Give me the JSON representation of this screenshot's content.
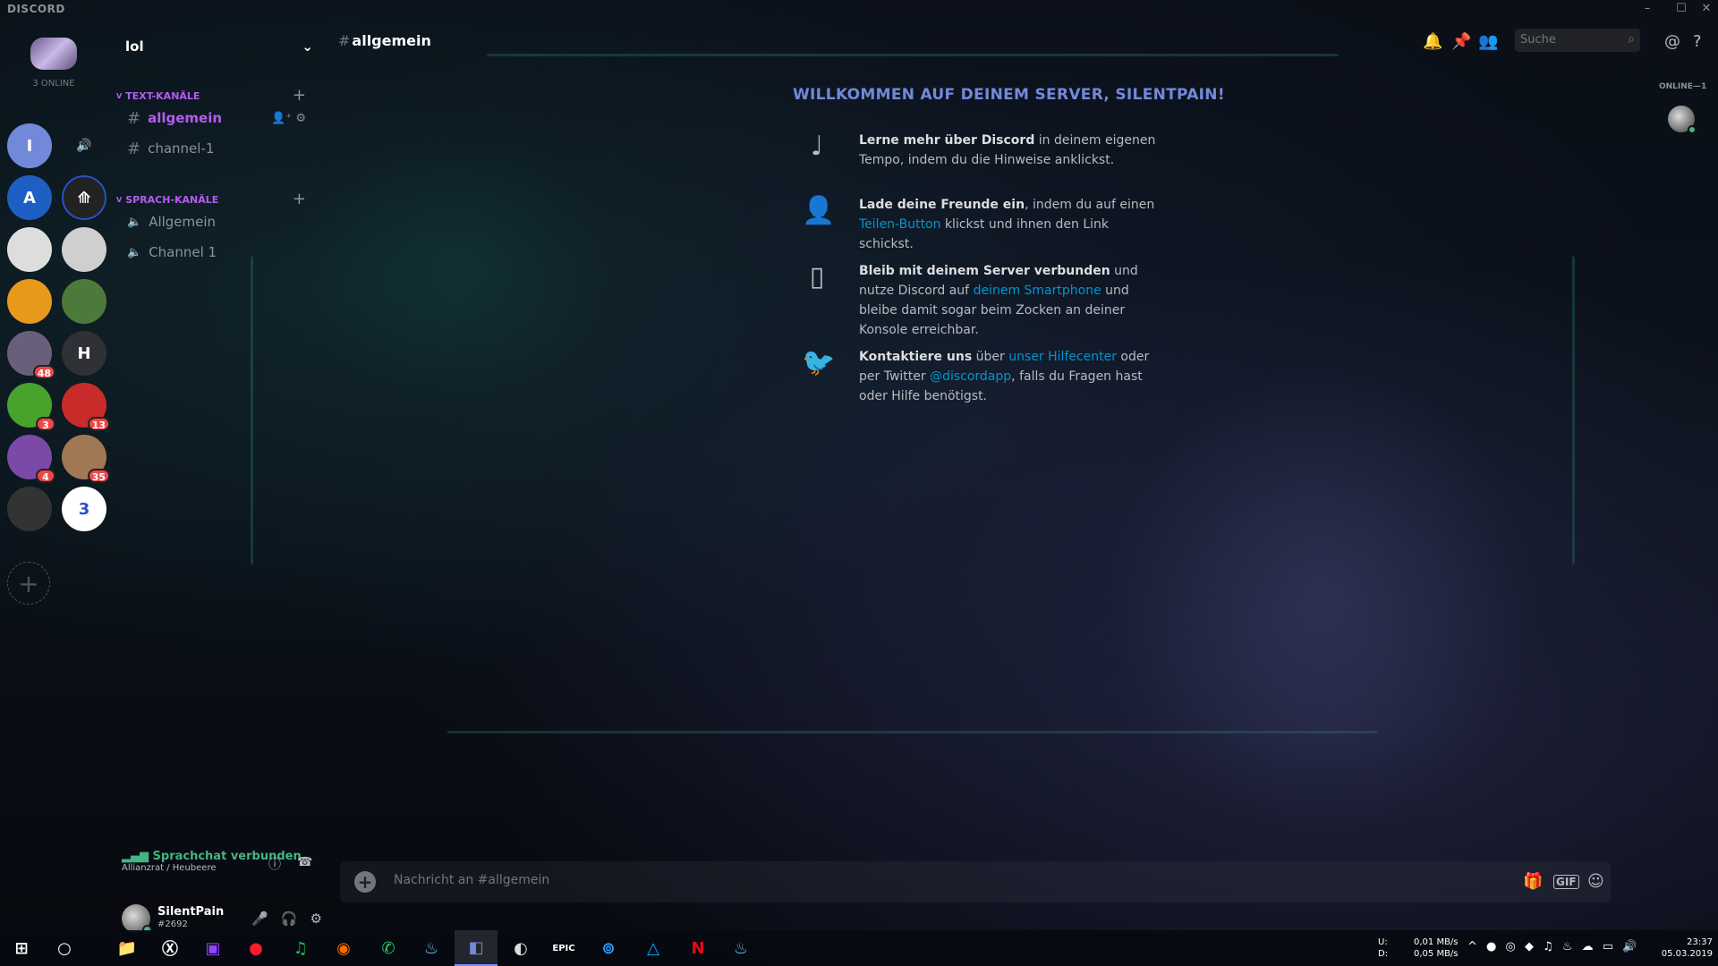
{
  "window": {
    "brand": "DISCORD",
    "minimize": "–",
    "maximize": "☐",
    "close": "✕"
  },
  "guilds": {
    "online_count": "3 ONLINE",
    "items": [
      {
        "label": "I",
        "color": "#7289da"
      },
      {
        "label": "A",
        "color": "#1d5fc4"
      },
      {
        "label": "",
        "color": "#222"
      },
      {
        "label": "",
        "color": "#ddd"
      },
      {
        "label": "",
        "color": "#cfcfcf"
      },
      {
        "label": "",
        "color": "#e69a1c"
      },
      {
        "label": "",
        "color": "#4d7a3a"
      },
      {
        "label": "",
        "color": "#6a5f7a"
      },
      {
        "label": "H",
        "color": "#2f3136"
      },
      {
        "label": "",
        "color": "#47a32c"
      },
      {
        "label": "",
        "color": "#c92a2a"
      },
      {
        "label": "",
        "color": "#7b4aa8"
      },
      {
        "label": "",
        "color": "#a07854"
      },
      {
        "label": "",
        "color": "#333"
      },
      {
        "label": "",
        "color": "#2a4fc9"
      }
    ],
    "badges": {
      "g8": "48",
      "g10": "3",
      "g11": "13",
      "g12": "4",
      "g13": "35"
    },
    "add_label": "+"
  },
  "server": {
    "name": "lol",
    "chevron": "⌄"
  },
  "categories": {
    "text": "TEXT-KANÄLE",
    "voice": "SPRACH-KANÄLE",
    "plus": "+",
    "caret": "v"
  },
  "text_channels": [
    {
      "hash": "#",
      "label": "allgemein"
    },
    {
      "hash": "#",
      "label": "channel-1"
    }
  ],
  "voice_channels": [
    {
      "icon": "🔈",
      "label": "Allgemein"
    },
    {
      "icon": "🔈",
      "label": "Channel 1"
    }
  ],
  "voice_status": {
    "title": "Sprachchat verbunden",
    "sub": "Allianzrat / Heubeere",
    "info": "ⓘ",
    "disconnect": "☎"
  },
  "user": {
    "name": "SilentPain",
    "disc": "#2692",
    "mic": "🎤",
    "headset": "🎧",
    "settings": "⚙"
  },
  "header": {
    "hash": "#",
    "channel": "allgemein",
    "bell": "🔔",
    "pin": "📌",
    "members": "👥",
    "search_placeholder": "Suche",
    "search_icon": "⌕",
    "at": "@",
    "help": "?"
  },
  "welcome": {
    "title": "WILLKOMMEN AUF DEINEM SERVER, SILENTPAIN!",
    "rows": [
      {
        "icon": "♩",
        "bold": "Lerne mehr über Discord",
        "text": " in deinem eigenen Tempo, indem du die Hinweise anklickst."
      },
      {
        "icon": "👤",
        "bold": "Lade deine Freunde ein",
        "text": ", indem du auf einen ",
        "link": "Teilen-Button",
        "after": " klickst und ihnen den Link schickst."
      },
      {
        "icon": "▯",
        "bold": "Bleib mit deinem Server verbunden",
        "text": " und nutze Discord auf ",
        "link": "deinem Smartphone",
        "after": " und bleibe damit sogar beim Zocken an deiner Konsole erreichbar."
      },
      {
        "icon": "🐦",
        "bold": "Kontaktiere uns",
        "text": " über ",
        "link": "unser Hilfecenter",
        "mid": " oder per Twitter ",
        "link2": "@discordapp",
        "after": ", falls du Fragen hast oder Hilfe benötigst."
      }
    ]
  },
  "input": {
    "placeholder": "Nachricht an #allgemein",
    "plus": "+",
    "gift": "🎁",
    "gif": "GIF",
    "emoji": "☺"
  },
  "members": {
    "header": "ONLINE—1"
  },
  "taskbar": {
    "start": "⊞",
    "apps": [
      "○",
      "📁",
      "Ⓧ",
      "▣",
      "●",
      "♫",
      "◉",
      "✆",
      "♨",
      "◧",
      "◐",
      "EPIC",
      "⊚",
      "△",
      "N",
      "♨"
    ],
    "net_labels": "U:\nD:",
    "net_up": "0,01 MB/s",
    "net_down": "0,05 MB/s",
    "tray_icons": "^ ● ◎ ◆ ♫ ♨ ☁ ▭ 🔊",
    "time": "23:37",
    "date": "05.03.2019"
  }
}
